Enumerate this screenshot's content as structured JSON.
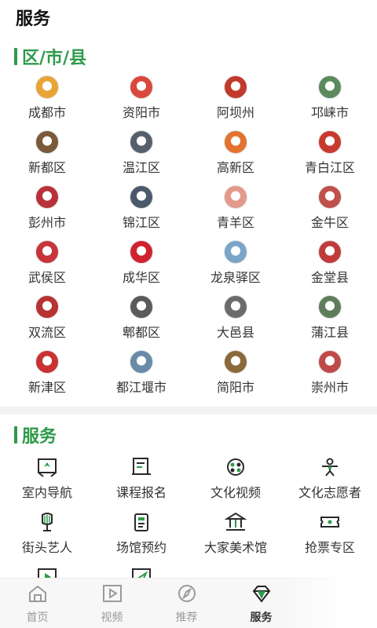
{
  "header": {
    "title": "服务"
  },
  "districts": {
    "section_title": "区/市/县",
    "items": [
      {
        "label": "成都市",
        "icon": "chengdu-emblem-icon",
        "color": "#e8a437"
      },
      {
        "label": "资阳市",
        "icon": "ziyang-emblem-icon",
        "color": "#d9483b"
      },
      {
        "label": "阿坝州",
        "icon": "aba-emblem-icon",
        "color": "#c0392b"
      },
      {
        "label": "邛崃市",
        "icon": "qionglai-emblem-icon",
        "color": "#5a8a5e"
      },
      {
        "label": "新都区",
        "icon": "xindu-emblem-icon",
        "color": "#7a5a3a"
      },
      {
        "label": "温江区",
        "icon": "wenjiang-emblem-icon",
        "color": "#55606b"
      },
      {
        "label": "高新区",
        "icon": "gaoxin-emblem-icon",
        "color": "#e3732e"
      },
      {
        "label": "青白江区",
        "icon": "qingbaijiang-emblem-icon",
        "color": "#c83a30"
      },
      {
        "label": "彭州市",
        "icon": "pengzhou-emblem-icon",
        "color": "#b8323a"
      },
      {
        "label": "锦江区",
        "icon": "jinjiang-emblem-icon",
        "color": "#4a5a6a"
      },
      {
        "label": "青羊区",
        "icon": "qingyang-emblem-icon",
        "color": "#e39a8a"
      },
      {
        "label": "金牛区",
        "icon": "jinniu-emblem-icon",
        "color": "#c0504a"
      },
      {
        "label": "武侯区",
        "icon": "wuhou-emblem-icon",
        "color": "#c7343a"
      },
      {
        "label": "成华区",
        "icon": "chenghua-emblem-icon",
        "color": "#d0222e"
      },
      {
        "label": "龙泉驿区",
        "icon": "longquanyi-emblem-icon",
        "color": "#7aa5c8"
      },
      {
        "label": "金堂县",
        "icon": "jintang-emblem-icon",
        "color": "#c23b3b"
      },
      {
        "label": "双流区",
        "icon": "shuangliu-emblem-icon",
        "color": "#b73232"
      },
      {
        "label": "郫都区",
        "icon": "pidu-emblem-icon",
        "color": "#5a5a5a"
      },
      {
        "label": "大邑县",
        "icon": "dayi-emblem-icon",
        "color": "#6b6b6b"
      },
      {
        "label": "蒲江县",
        "icon": "pujiang-emblem-icon",
        "color": "#5f7d5a"
      },
      {
        "label": "新津区",
        "icon": "xinjin-emblem-icon",
        "color": "#c83232"
      },
      {
        "label": "都江堰市",
        "icon": "dujiangyan-emblem-icon",
        "color": "#6a8aa8"
      },
      {
        "label": "简阳市",
        "icon": "jianyang-emblem-icon",
        "color": "#8a6a3a"
      },
      {
        "label": "崇州市",
        "icon": "chongzhou-emblem-icon",
        "color": "#c04a4a"
      }
    ]
  },
  "services": {
    "section_title": "服务",
    "items": [
      {
        "label": "室内导航",
        "icon": "indoor-navigation-icon"
      },
      {
        "label": "课程报名",
        "icon": "course-signup-icon"
      },
      {
        "label": "文化视频",
        "icon": "culture-video-icon"
      },
      {
        "label": "文化志愿者",
        "icon": "volunteer-icon"
      },
      {
        "label": "街头艺人",
        "icon": "street-artist-icon"
      },
      {
        "label": "场馆预约",
        "icon": "venue-booking-icon"
      },
      {
        "label": "大家美术馆",
        "icon": "art-museum-icon"
      },
      {
        "label": "抢票专区",
        "icon": "ticket-grab-icon"
      },
      {
        "label": "",
        "icon": "play-button-icon"
      },
      {
        "label": "",
        "icon": "send-icon"
      }
    ]
  },
  "bottom_nav": {
    "items": [
      {
        "label": "首页",
        "icon": "home-icon",
        "active": false
      },
      {
        "label": "视频",
        "icon": "video-icon",
        "active": false
      },
      {
        "label": "推荐",
        "icon": "compass-icon",
        "active": false
      },
      {
        "label": "服务",
        "icon": "diamond-icon",
        "active": true
      }
    ]
  },
  "colors": {
    "accent": "#2e9a4a",
    "text": "#333333",
    "muted": "#9a9a9a"
  }
}
